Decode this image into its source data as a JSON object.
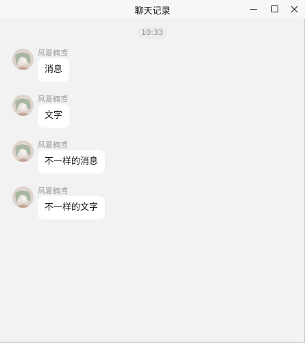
{
  "window": {
    "title": "聊天记录",
    "minimize_icon": "minimize-icon",
    "maximize_icon": "maximize-icon",
    "close_icon": "close-icon"
  },
  "chat": {
    "timestamp": "10:33",
    "messages": [
      {
        "sender": "风夏楠鸢",
        "text": "消息",
        "avatar_icon": "user-avatar"
      },
      {
        "sender": "风夏楠鸢",
        "text": "文字",
        "avatar_icon": "user-avatar"
      },
      {
        "sender": "风夏楠鸢",
        "text": "不一样的消息",
        "avatar_icon": "user-avatar"
      },
      {
        "sender": "风夏楠鸢",
        "text": "不一样的文字",
        "avatar_icon": "user-avatar"
      }
    ]
  },
  "colors": {
    "background": "#f2f2f2",
    "bubble": "#ffffff",
    "sender_text": "#9a9a9a",
    "timestamp_badge": "#ececec"
  }
}
